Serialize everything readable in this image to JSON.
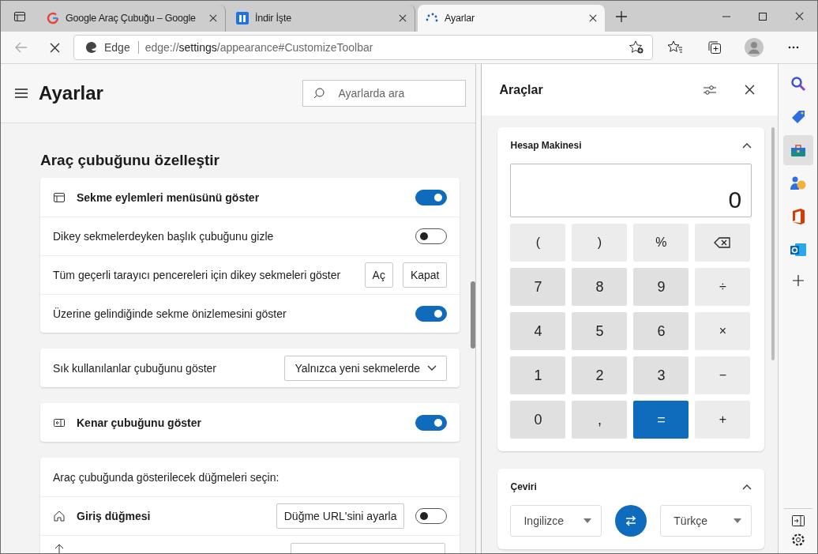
{
  "tabs": [
    {
      "title": "Google Araç Çubuğu – Google",
      "selected": false,
      "kind": "google"
    },
    {
      "title": "İndir İşte",
      "selected": false,
      "kind": "site"
    },
    {
      "title": "Ayarlar",
      "selected": true,
      "kind": "loading"
    }
  ],
  "address_bar": {
    "site_label": "Edge",
    "url": "edge://**settings**/appearance#CustomizeToolbar"
  },
  "settings": {
    "title": "Ayarlar",
    "search": {
      "placeholder": "Ayarlarda ara"
    },
    "section_title": "Araç çubuğunu özelleştir",
    "cards": [
      {
        "rows": [
          {
            "kind": "toggle",
            "label": "Sekme eylemleri menüsünü göster",
            "on": true
          },
          {
            "kind": "toggle",
            "label": "Dikey sekmelerdeyken başlık çubuğunu gizle",
            "on": false
          },
          {
            "kind": "buttons",
            "label": "Tüm geçerli tarayıcı pencereleri için dikey sekmeleri göster",
            "buttons": [
              "Aç",
              "Kapat"
            ]
          },
          {
            "kind": "toggle",
            "label": "Üzerine gelindiğinde sekme önizlemesini göster",
            "on": true
          }
        ]
      },
      {
        "rows": [
          {
            "kind": "dropdown",
            "label": "Sık kullanılanlar çubuğunu göster",
            "value": "Yalnızca yeni sekmelerde"
          }
        ]
      },
      {
        "rows": [
          {
            "kind": "toggle",
            "label": "Kenar çubuğunu göster",
            "on": true
          }
        ]
      },
      {
        "rows": [
          {
            "kind": "heading",
            "label": "Araç çubuğunda gösterilecek düğmeleri seçin:"
          },
          {
            "kind": "button_toggle",
            "label": "Giriş düğmesi",
            "button": "Düğme URL'sini ayarla",
            "on": false
          },
          {
            "kind": "partial"
          }
        ]
      }
    ]
  },
  "tools_panel": {
    "title": "Araçlar",
    "calculator": {
      "title": "Hesap Makinesi",
      "display": "0",
      "keys": [
        {
          "label": "(",
          "kind": "op"
        },
        {
          "label": ")",
          "kind": "op"
        },
        {
          "label": "%",
          "kind": "op"
        },
        {
          "kind": "backspace"
        },
        {
          "label": "7",
          "kind": "digit"
        },
        {
          "label": "8",
          "kind": "digit"
        },
        {
          "label": "9",
          "kind": "digit"
        },
        {
          "label": "÷",
          "kind": "op"
        },
        {
          "label": "4",
          "kind": "digit"
        },
        {
          "label": "5",
          "kind": "digit"
        },
        {
          "label": "6",
          "kind": "digit"
        },
        {
          "label": "×",
          "kind": "op"
        },
        {
          "label": "1",
          "kind": "digit"
        },
        {
          "label": "2",
          "kind": "digit"
        },
        {
          "label": "3",
          "kind": "digit"
        },
        {
          "label": "−",
          "kind": "op"
        },
        {
          "label": "0",
          "kind": "digit"
        },
        {
          "label": ",",
          "kind": "digit"
        },
        {
          "label": "=",
          "kind": "equals"
        },
        {
          "label": "+",
          "kind": "op"
        }
      ]
    },
    "translator": {
      "title": "Çeviri",
      "from": "Ingilizce",
      "to": "Türkçe"
    }
  },
  "sidebar": {
    "items": [
      {
        "selected": false
      },
      {
        "selected": false
      },
      {
        "selected": true
      },
      {
        "selected": false
      },
      {
        "selected": false
      },
      {
        "selected": false
      }
    ]
  }
}
